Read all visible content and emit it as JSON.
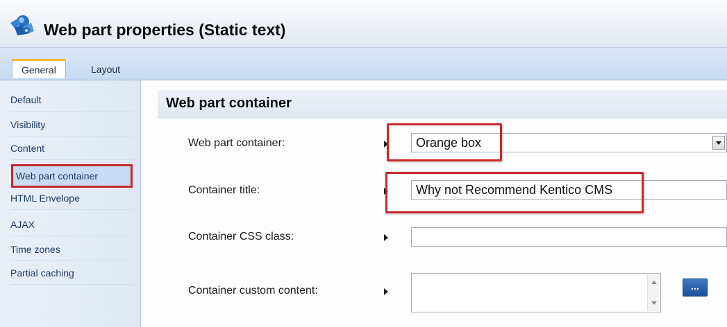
{
  "window": {
    "title": "Web part properties (Static text)",
    "icon": "web-part-icon"
  },
  "tabs": [
    {
      "label": "General",
      "active": true
    },
    {
      "label": "Layout",
      "active": false
    }
  ],
  "sidebar": {
    "items": [
      {
        "label": "Default"
      },
      {
        "label": "Visibility"
      },
      {
        "label": "Content"
      },
      {
        "label": "Web part container",
        "selected": true
      },
      {
        "label": "HTML Envelope"
      },
      {
        "label": "AJAX"
      },
      {
        "label": "Time zones"
      },
      {
        "label": "Partial caching"
      }
    ]
  },
  "section": {
    "title": "Web part container"
  },
  "form": {
    "container": {
      "label": "Web part container:",
      "value": "Orange box"
    },
    "title": {
      "label": "Container title:",
      "value": "Why not Recommend Kentico CMS"
    },
    "css_class": {
      "label": "Container CSS class:",
      "value": ""
    },
    "custom_content": {
      "label": "Container custom content:",
      "value": "",
      "button_label": "..."
    }
  },
  "colors": {
    "highlight": "#c8272d",
    "accent": "#f7b63a",
    "button": "#2b63ad"
  }
}
